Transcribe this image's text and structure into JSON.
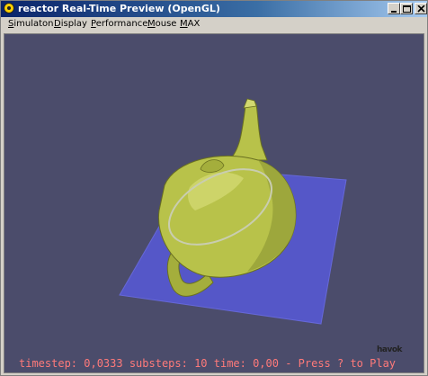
{
  "window": {
    "title": "reactor Real-Time Preview (OpenGL)",
    "app_icon": "reactor-icon"
  },
  "controls": {
    "minimize_icon": "minimize-icon",
    "maximize_icon": "maximize-icon",
    "close_icon": "close-icon"
  },
  "menu": {
    "items": [
      {
        "label": "Simulaton",
        "underline": "S",
        "rest": "imulaton"
      },
      {
        "label": "Display",
        "underline": "D",
        "rest": "isplay"
      },
      {
        "label": "Performance",
        "underline": "P",
        "rest": "erformance"
      },
      {
        "label": "Mouse",
        "underline": "M",
        "rest": "ouse"
      },
      {
        "label": "MAX",
        "underline": "M",
        "rest": "AX"
      }
    ]
  },
  "viewport": {
    "background": "#4b4c6b",
    "plane_color": "#5557c8",
    "teapot_color": "#b8c24a",
    "status_text": "timestep: 0,0333 substeps: 10 time: 0,00 - Press ? to Play",
    "status_color": "#ff7a7a",
    "logo_text": "havok"
  }
}
